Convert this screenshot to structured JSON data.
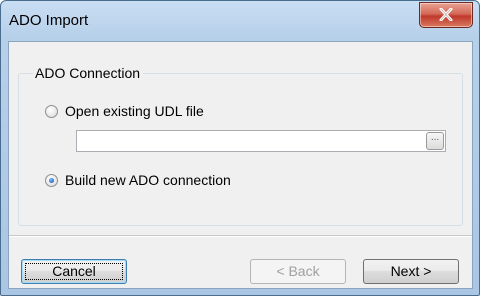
{
  "window": {
    "title": "ADO Import",
    "close_icon": "close-x-icon"
  },
  "group": {
    "legend": "ADO Connection"
  },
  "options": {
    "open_existing_label": "Open existing UDL file",
    "build_new_label": "Build new ADO connection",
    "selected": "build_new"
  },
  "udl_path": {
    "value": "",
    "browse_label": "..."
  },
  "buttons": {
    "cancel": "Cancel",
    "back": "< Back",
    "next": "Next >"
  },
  "colors": {
    "titlebar": "#b7d0ea",
    "close_button": "#c0392b",
    "dialog_background": "#f0f0f0"
  }
}
